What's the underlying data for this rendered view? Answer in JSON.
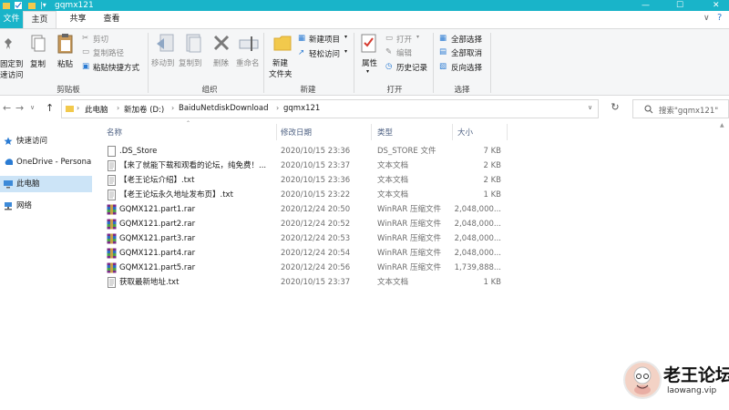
{
  "window": {
    "title": "gqmx121",
    "controls": {
      "minimize": "—",
      "maximize": "☐",
      "close": "✕"
    }
  },
  "tabs": {
    "file": "文件",
    "home": "主页",
    "share": "共享",
    "view": "查看"
  },
  "ribbon": {
    "clipboard": {
      "pin": "固定到\n速访问",
      "pin_line1": "固定到",
      "pin_line2": "速访问",
      "copy": "复制",
      "paste": "粘贴",
      "cut": "剪切",
      "copy_path": "复制路径",
      "paste_shortcut": "粘贴快捷方式",
      "group_label": "剪贴板"
    },
    "organize": {
      "move_to": "移动到",
      "copy_to": "复制到",
      "delete": "删除",
      "rename": "重命名",
      "group_label": "组织"
    },
    "new": {
      "new_item": "新建项目",
      "easy_access": "轻松访问",
      "new_folder_line1": "新建",
      "new_folder_line2": "文件夹",
      "group_label": "新建"
    },
    "open": {
      "properties": "属性",
      "open": "打开",
      "edit": "编辑",
      "history": "历史记录",
      "group_label": "打开"
    },
    "select": {
      "select_all": "全部选择",
      "select_none": "全部取消",
      "invert": "反向选择",
      "group_label": "选择"
    }
  },
  "address": {
    "crumbs": [
      "此电脑",
      "新加卷 (D:)",
      "BaiduNetdiskDownload",
      "gqmx121"
    ],
    "search_placeholder": "搜索\"gqmx121\""
  },
  "navpane": {
    "items": [
      {
        "label": "快速访问",
        "icon": "star-icon"
      },
      {
        "label": "OneDrive - Persona",
        "icon": "cloud-icon"
      },
      {
        "label": "此电脑",
        "icon": "computer-icon"
      },
      {
        "label": "网络",
        "icon": "network-icon"
      }
    ]
  },
  "columns": {
    "name": "名称",
    "date": "修改日期",
    "type": "类型",
    "size": "大小"
  },
  "files": [
    {
      "name": ".DS_Store",
      "date": "2020/10/15 23:36",
      "type": "DS_STORE 文件",
      "size": "7 KB",
      "icon": "blank-file-icon"
    },
    {
      "name": "【来了就能下载和观看的论坛，纯免费！...",
      "date": "2020/10/15 23:37",
      "type": "文本文档",
      "size": "2 KB",
      "icon": "text-file-icon"
    },
    {
      "name": "【老王论坛介绍】.txt",
      "date": "2020/10/15 23:36",
      "type": "文本文档",
      "size": "2 KB",
      "icon": "text-file-icon"
    },
    {
      "name": "【老王论坛永久地址发布页】.txt",
      "date": "2020/10/15 23:22",
      "type": "文本文档",
      "size": "1 KB",
      "icon": "text-file-icon"
    },
    {
      "name": "GQMX121.part1.rar",
      "date": "2020/12/24 20:50",
      "type": "WinRAR 压缩文件",
      "size": "2,048,000...",
      "icon": "rar-icon"
    },
    {
      "name": "GQMX121.part2.rar",
      "date": "2020/12/24 20:52",
      "type": "WinRAR 压缩文件",
      "size": "2,048,000...",
      "icon": "rar-icon"
    },
    {
      "name": "GQMX121.part3.rar",
      "date": "2020/12/24 20:53",
      "type": "WinRAR 压缩文件",
      "size": "2,048,000...",
      "icon": "rar-icon"
    },
    {
      "name": "GQMX121.part4.rar",
      "date": "2020/12/24 20:54",
      "type": "WinRAR 压缩文件",
      "size": "2,048,000...",
      "icon": "rar-icon"
    },
    {
      "name": "GQMX121.part5.rar",
      "date": "2020/12/24 20:56",
      "type": "WinRAR 压缩文件",
      "size": "1,739,888...",
      "icon": "rar-icon"
    },
    {
      "name": "获取最新地址.txt",
      "date": "2020/10/15 23:37",
      "type": "文本文档",
      "size": "1 KB",
      "icon": "text-file-icon"
    }
  ],
  "watermark": {
    "title": "老王论坛",
    "url": "laowang.vip"
  },
  "colors": {
    "accent": "#19b4c9",
    "ribbon_bg": "#f5f6f7",
    "selected": "#cce4f7",
    "header_text": "#4d6082"
  }
}
